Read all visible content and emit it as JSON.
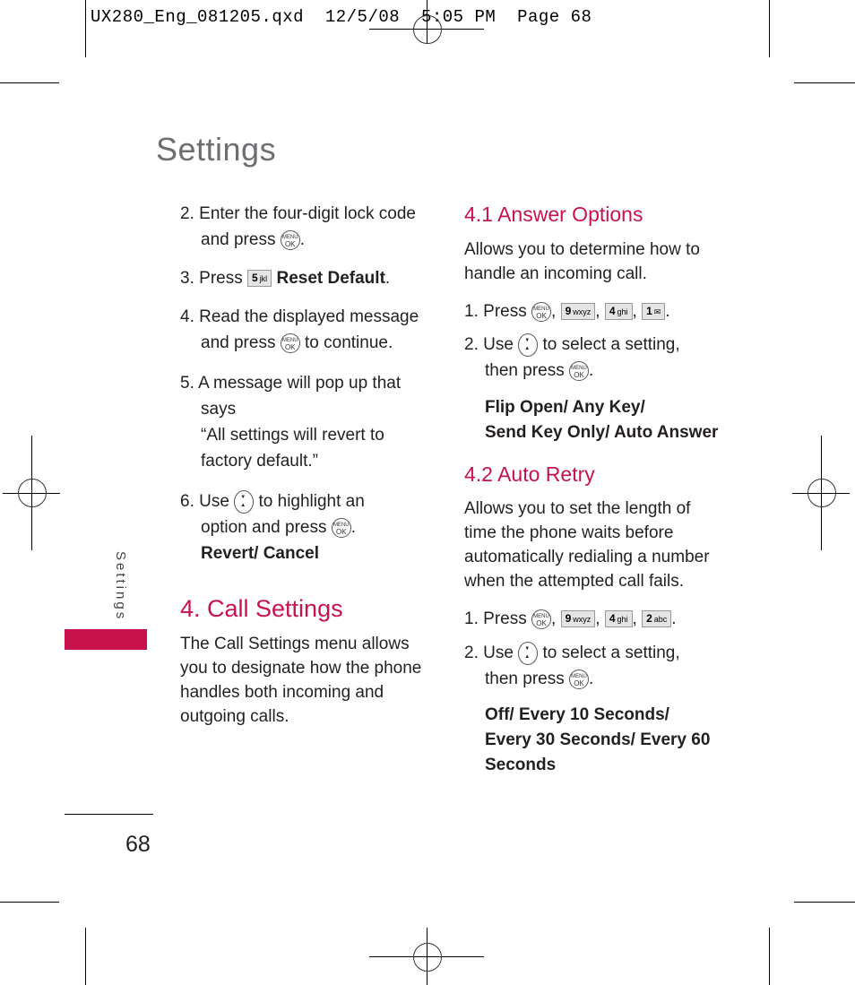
{
  "slug_line": "UX280_Eng_081205.qxd  12/5/08  5:05 PM  Page 68",
  "page_title": "Settings",
  "sidebar_label": "Settings",
  "page_number": "68",
  "accent_color": "#c8124c",
  "left_column": {
    "steps": [
      {
        "num": "2.",
        "lines": [
          "Enter the four-digit lock code",
          "and press"
        ],
        "icon": "menu-ok-icon"
      },
      {
        "num": "3.",
        "text": "Press",
        "key": {
          "digit": "5",
          "letters": "jkl"
        },
        "bold": "Reset Default",
        "suffix": "."
      },
      {
        "num": "4.",
        "lines": [
          "Read the displayed message",
          "and press"
        ],
        "after_icon": "to continue.",
        "icon": "menu-ok-icon"
      },
      {
        "num": "5.",
        "lines": [
          "A message will pop up that",
          "says",
          "“All settings will revert to",
          "factory default.”"
        ]
      },
      {
        "num": "6.",
        "line1a": "Use",
        "line1b": "to highlight an",
        "line2": "option and press",
        "options": "Revert/ Cancel"
      }
    ],
    "section": {
      "heading": "4. Call Settings",
      "body": [
        "The Call Settings menu allows",
        "you to designate how the phone",
        "handles both incoming and",
        "outgoing calls."
      ]
    }
  },
  "right_column": {
    "sub1": {
      "heading": "4.1 Answer Options",
      "body": [
        "Allows you to determine how to",
        "handle an incoming call."
      ],
      "step1": {
        "num": "1.",
        "text": "Press",
        "keys": [
          {
            "digit": "9",
            "letters": "wxyz"
          },
          {
            "digit": "4",
            "letters": "ghi"
          },
          {
            "digit": "1",
            "letters": "✉"
          }
        ]
      },
      "step2": {
        "num": "2.",
        "a": "Use",
        "b": "to select a setting,",
        "c": "then press"
      },
      "options": [
        "Flip Open/ Any Key/",
        "Send Key Only/ Auto Answer"
      ]
    },
    "sub2": {
      "heading": "4.2 Auto Retry",
      "body": [
        "Allows you to set the length of",
        "time the phone waits before",
        "automatically redialing a number",
        "when the attempted call fails."
      ],
      "step1": {
        "num": "1.",
        "text": "Press",
        "keys": [
          {
            "digit": "9",
            "letters": "wxyz"
          },
          {
            "digit": "4",
            "letters": "ghi"
          },
          {
            "digit": "2",
            "letters": "abc"
          }
        ]
      },
      "step2": {
        "num": "2.",
        "a": "Use",
        "b": "to select a setting,",
        "c": "then press"
      },
      "options": [
        "Off/ Every 10 Seconds/",
        "Every 30 Seconds/ Every 60",
        "Seconds"
      ]
    }
  },
  "ok_key": {
    "top": "MENU",
    "bottom": "OK"
  }
}
